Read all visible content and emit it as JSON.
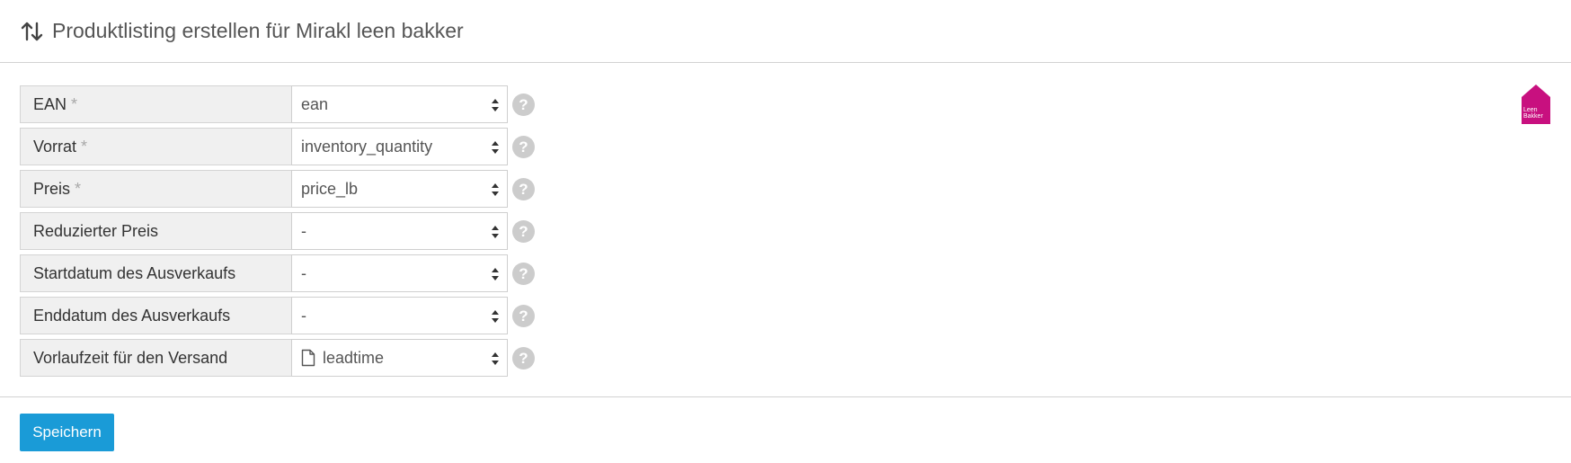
{
  "header": {
    "title": "Produktlisting erstellen für Mirakl leen bakker",
    "icon": "sort-arrows-icon"
  },
  "logo": {
    "text_line1": "Leen",
    "text_line2": "Bakker",
    "color": "#c8107f"
  },
  "form": {
    "rows": [
      {
        "label": "EAN",
        "required": "*",
        "value": "ean",
        "has_file_icon": false
      },
      {
        "label": "Vorrat",
        "required": "*",
        "value": "inventory_quantity",
        "has_file_icon": false
      },
      {
        "label": "Preis",
        "required": "*",
        "value": "price_lb",
        "has_file_icon": false
      },
      {
        "label": "Reduzierter Preis",
        "required": "",
        "value": "-",
        "has_file_icon": false
      },
      {
        "label": "Startdatum des Ausverkaufs",
        "required": "",
        "value": "-",
        "has_file_icon": false
      },
      {
        "label": "Enddatum des Ausverkaufs",
        "required": "",
        "value": "-",
        "has_file_icon": false
      },
      {
        "label": "Vorlaufzeit für den Versand",
        "required": "",
        "value": "leadtime",
        "has_file_icon": true
      }
    ],
    "help_glyph": "?"
  },
  "actions": {
    "save_label": "Speichern",
    "save_color": "#1a9bd7"
  }
}
